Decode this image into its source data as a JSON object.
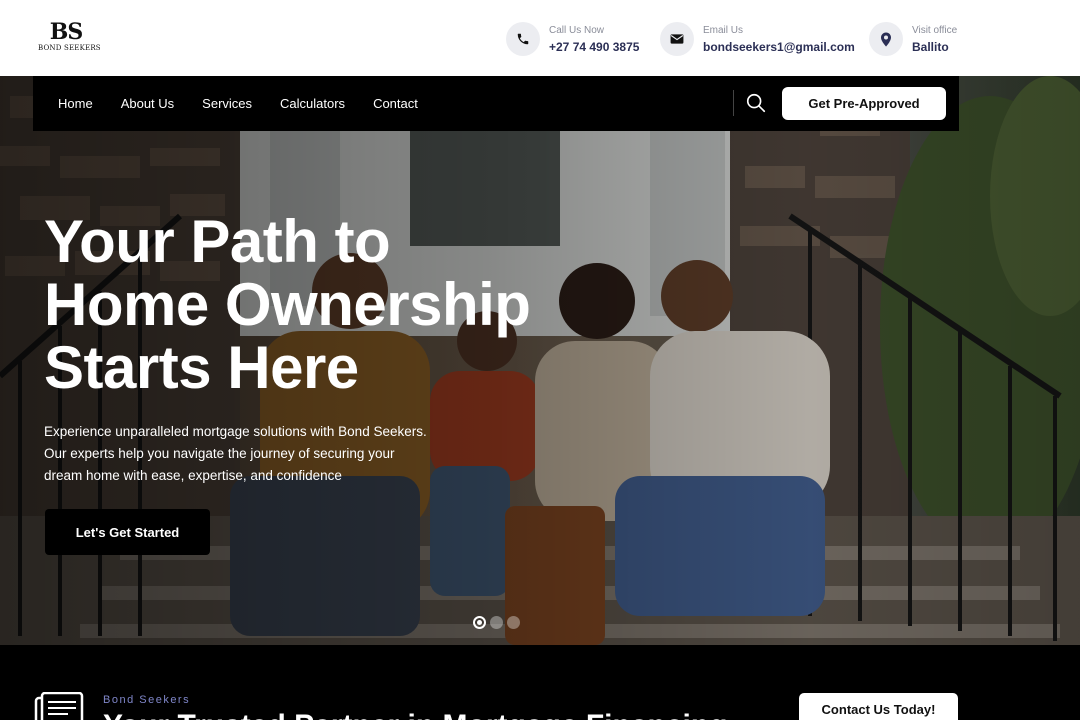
{
  "logo": {
    "mark": "BS",
    "name": "BOND SEEKERS"
  },
  "contacts": [
    {
      "label": "Call Us Now",
      "value": "+27 74 490 3875",
      "icon": "phone-icon"
    },
    {
      "label": "Email Us",
      "value": "bondseekers1@gmail.com",
      "icon": "envelope-icon"
    },
    {
      "label": "Visit office",
      "value": "Ballito",
      "icon": "map-pin-icon"
    }
  ],
  "nav": {
    "items": [
      {
        "label": "Home"
      },
      {
        "label": "About Us"
      },
      {
        "label": "Services"
      },
      {
        "label": "Calculators"
      },
      {
        "label": "Contact"
      }
    ],
    "search_icon": "search-icon",
    "cta": "Get Pre-Approved"
  },
  "hero": {
    "headline": [
      "Your Path to",
      "Home Ownership",
      "Starts Here"
    ],
    "subtext": [
      "Experience unparalleled mortgage solutions with Bond Seekers.",
      "Our experts help you navigate the journey of securing your",
      "dream home with ease, expertise, and confidence"
    ],
    "cta": "Let's Get Started",
    "slides": {
      "count": 3,
      "active": 1
    }
  },
  "bottom": {
    "kicker": "Bond Seekers",
    "title": "Your Trusted Partner in Mortgage Financing",
    "cta": "Contact Us Today!"
  },
  "colors": {
    "navy_text": "#2b2f55",
    "kicker": "#7f86c9",
    "nav_bg": "#000000",
    "cta_bg": "#ffffff"
  }
}
